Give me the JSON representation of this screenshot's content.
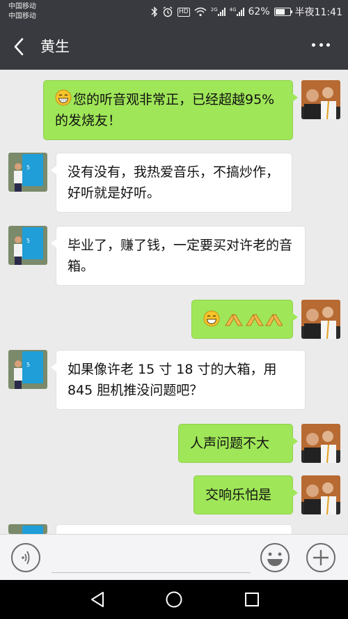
{
  "status_bar": {
    "carrier_1": "中国移动",
    "carrier_2": "中国移动",
    "network_1": "2G",
    "network_2": "4G",
    "battery_percent": "62%",
    "battery_level": 0.62,
    "time": "半夜11:41",
    "hd": "HD"
  },
  "header": {
    "title": "黄生"
  },
  "messages": [
    {
      "side": "me",
      "emoji": "grin",
      "text": "您的听音观非常正，已经超越95% 的发烧友！"
    },
    {
      "side": "other",
      "text": "没有没有，我热爱音乐，不搞炒作，好听就是好听。"
    },
    {
      "side": "other",
      "text": "毕业了，赚了钱，一定要买对许老的音箱。"
    },
    {
      "side": "me",
      "emoji": "grin-and-three-hands"
    },
    {
      "side": "other",
      "text": "如果像许老 15 寸 18 寸的大箱，用 845 胆机推没问题吧？"
    },
    {
      "side": "me",
      "text": "人声问题不大"
    },
    {
      "side": "me",
      "text": "交响乐怕是"
    }
  ],
  "colors": {
    "my_bubble": "#9fe658",
    "their_bubble": "#ffffff",
    "header_bg": "#393a3f",
    "chat_bg": "#ebebeb"
  }
}
